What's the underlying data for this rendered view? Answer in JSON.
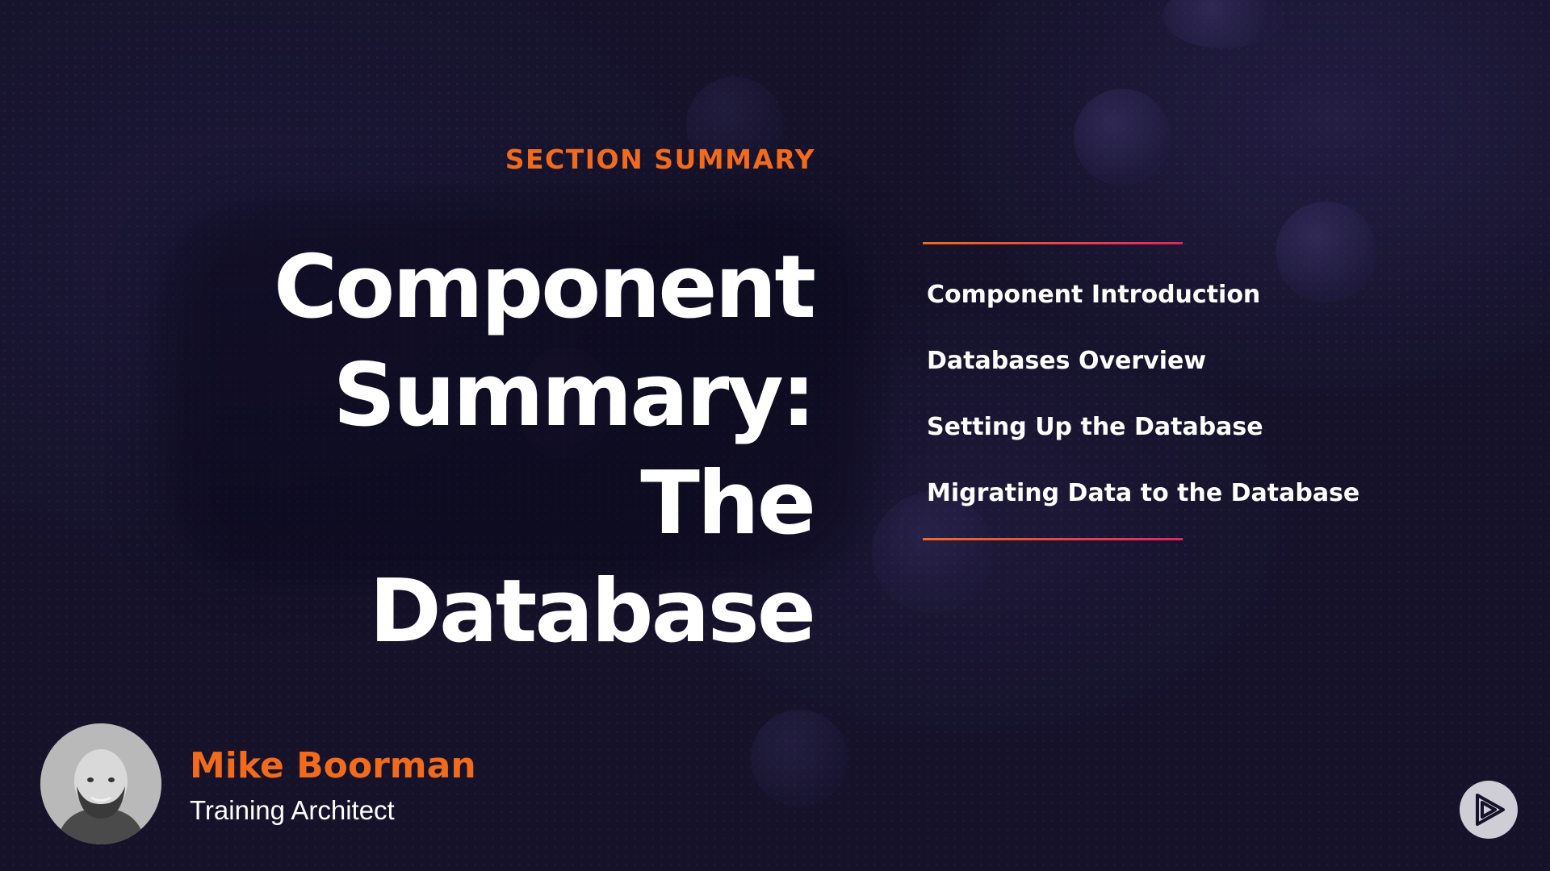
{
  "slide": {
    "section_label": "SECTION SUMMARY",
    "title_lines": [
      "Component",
      "Summary: The",
      "Database"
    ],
    "topics": [
      "Component Introduction",
      "Databases Overview",
      "Setting Up the Database",
      "Migrating Data to the Database"
    ]
  },
  "presenter": {
    "name": "Mike Boorman",
    "role": "Training Architect"
  },
  "colors": {
    "background": "#15122a",
    "accent_orange": "#f26b1d",
    "accent_pink": "#e6245e",
    "text_primary": "#ffffff"
  },
  "icons": {
    "brand_logo": "play-logo-icon",
    "avatar": "presenter-avatar"
  }
}
